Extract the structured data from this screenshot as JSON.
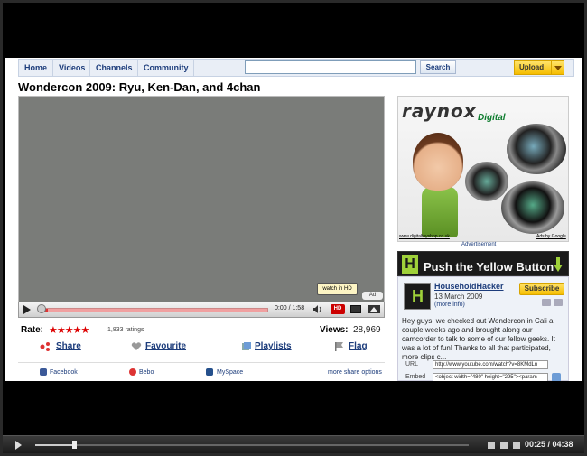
{
  "nav": {
    "home": "Home",
    "videos": "Videos",
    "channels": "Channels",
    "community": "Community",
    "search_value": "",
    "search_button": "Search",
    "upload": "Upload"
  },
  "video": {
    "title": "Wondercon 2009: Ryu, Ken-Dan, and 4chan",
    "watch_hd_tooltip": "watch in HD",
    "ad_badge": "Ad",
    "time": "0:00 / 1:58",
    "hd": "HD"
  },
  "rating": {
    "label": "Rate:",
    "stars": "★★★★★",
    "count": "1,833 ratings",
    "views_label": "Views:",
    "views": "28,969"
  },
  "actions": {
    "share": "Share",
    "favourite": "Favourite",
    "playlists": "Playlists",
    "flag": "Flag"
  },
  "share_links": {
    "facebook": "Facebook",
    "bebo": "Bebo",
    "myspace": "MySpace",
    "more": "more share options"
  },
  "ad": {
    "logo": "raynox",
    "logo_sub": "Digital",
    "url": "www.digitaltoyshop.co.uk",
    "google": "Ads by Google",
    "label": "Advertisement"
  },
  "banner": {
    "letter": "H",
    "text": "Push the Yellow Button"
  },
  "channel": {
    "name": "HouseholdHacker",
    "date": "13 March 2009",
    "more_info": "(more info)",
    "subscribe": "Subscribe",
    "description": "Hey guys, we checked out Wondercon in Cali a couple weeks ago and brought along our camcorder to talk to some of our fellow geeks. It was a lot of fun! Thanks to all that participated, more clips c...",
    "url_label": "URL",
    "url_value": "http://www.youtube.com/watch?v=8KMdLn",
    "embed_label": "Embed",
    "embed_value": "<object width=\"480\" height=\"295\"><param"
  },
  "bottom_bar": {
    "time": "00:25 / 04:38",
    "progress": 0.09
  },
  "colors": {
    "accent_yellow": "#f5bd00",
    "link_blue": "#1c3c7b",
    "hd_red": "#cc0000",
    "brand_green": "#9fd13a"
  }
}
